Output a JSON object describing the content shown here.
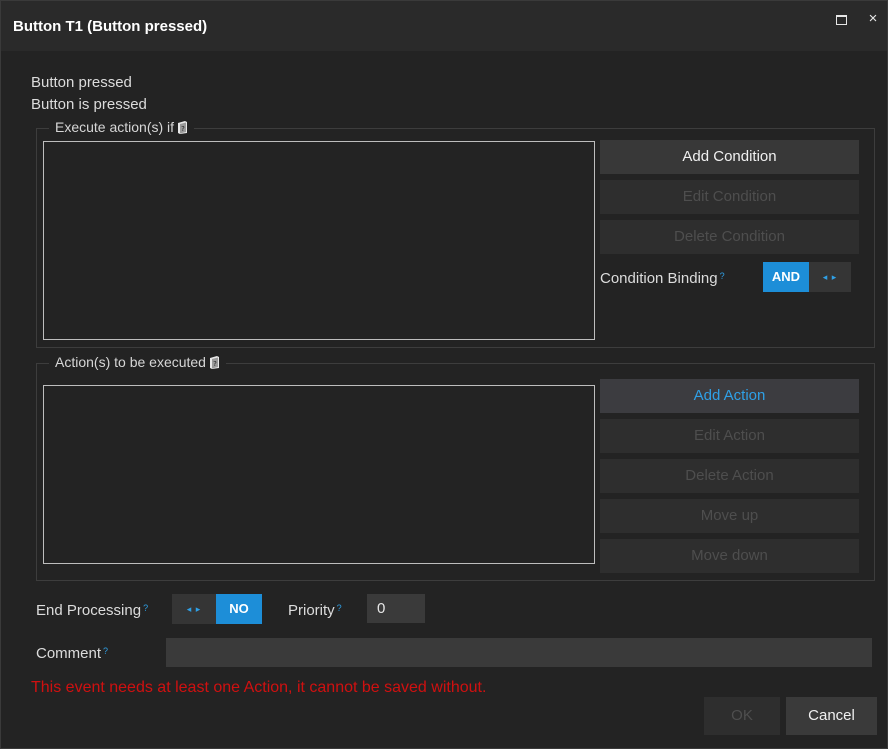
{
  "window": {
    "title": "Button T1 (Button pressed)",
    "maximize_icon": "maximize-icon",
    "close_label": "×"
  },
  "event": {
    "name": "Button pressed",
    "description": "Button is pressed"
  },
  "conditions_group": {
    "legend": "Execute action(s) if",
    "buttons": {
      "add": "Add Condition",
      "edit": "Edit Condition",
      "delete": "Delete Condition"
    },
    "binding_label": "Condition Binding",
    "binding_value": "AND",
    "binding_arrows": "◂ ▸"
  },
  "actions_group": {
    "legend": "Action(s) to be executed",
    "buttons": {
      "add": "Add Action",
      "edit": "Edit Action",
      "delete": "Delete Action",
      "move_up": "Move up",
      "move_down": "Move down"
    }
  },
  "options": {
    "end_processing_label": "End Processing",
    "end_processing_arrows": "◂ ▸",
    "end_processing_value": "NO",
    "priority_label": "Priority",
    "priority_value": "0",
    "comment_label": "Comment",
    "comment_value": "",
    "help_mark": "?"
  },
  "error_message": "This event needs at least one Action, it cannot be saved without.",
  "footer": {
    "ok_label": "OK",
    "cancel_label": "Cancel"
  },
  "colors": {
    "accent": "#1d8ed8",
    "accent_text": "#2fa0e6",
    "error": "#d01010",
    "background": "#232323"
  }
}
